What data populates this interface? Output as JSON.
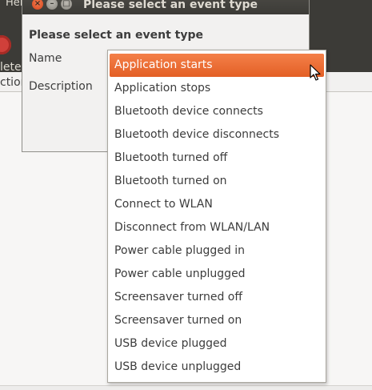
{
  "background_window": {
    "menu_help": "Hel",
    "toolbar_label": "lete",
    "header_label": "ction"
  },
  "dialog": {
    "title": "Please select an event type",
    "heading": "Please select an event type",
    "name_label": "Name",
    "description_label": "Description",
    "window_buttons": {
      "close": "×",
      "minimize": "–",
      "maximize": "□"
    }
  },
  "event_type_dropdown": {
    "selected": "Application starts",
    "options": [
      "Application starts",
      "Application stops",
      "Bluetooth device connects",
      "Bluetooth device disconnects",
      "Bluetooth turned off",
      "Bluetooth turned on",
      "Connect to WLAN",
      "Disconnect from WLAN/LAN",
      "Power cable plugged in",
      "Power cable unplugged",
      "Screensaver turned off",
      "Screensaver turned on",
      "USB device plugged",
      "USB device unplugged"
    ]
  },
  "icons": {
    "toolbar_delete": "delete-icon",
    "cursor": "mouse-pointer-icon"
  },
  "colors": {
    "selection": "#e95e25",
    "titlebar": "#3c3b37",
    "dialog_bg": "#f2f1f0",
    "close_button": "#e25a23"
  }
}
